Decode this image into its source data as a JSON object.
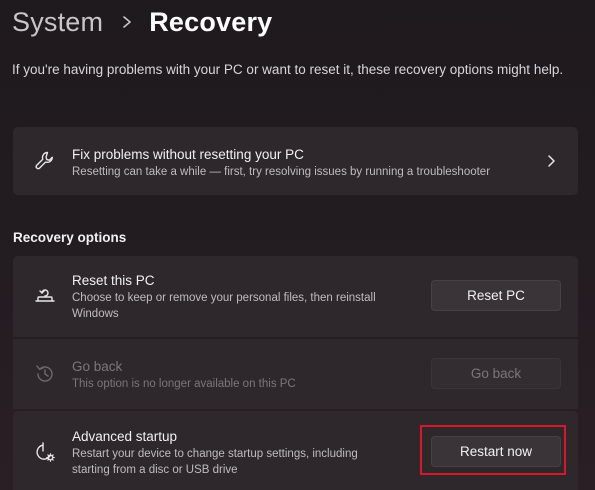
{
  "breadcrumb": {
    "parent": "System",
    "current": "Recovery",
    "separator_icon": "chevron-right-icon"
  },
  "intro_text": "If you're having problems with your PC or want to reset it, these recovery options might help.",
  "fix_card": {
    "icon": "wrench-icon",
    "title": "Fix problems without resetting your PC",
    "description": "Resetting can take a while — first, try resolving issues by running a troubleshooter",
    "chevron_icon": "chevron-right-icon"
  },
  "recovery_section": {
    "title": "Recovery options",
    "options": [
      {
        "icon": "reset-pc-icon",
        "title": "Reset this PC",
        "description": "Choose to keep or remove your personal files, then reinstall Windows",
        "button_label": "Reset PC",
        "enabled": true
      },
      {
        "icon": "history-icon",
        "title": "Go back",
        "description": "This option is no longer available on this PC",
        "button_label": "Go back",
        "enabled": false
      },
      {
        "icon": "advanced-startup-icon",
        "title": "Advanced startup",
        "description": "Restart your device to change startup settings, including starting from a disc or USB drive",
        "button_label": "Restart now",
        "enabled": true,
        "highlighted": true
      }
    ]
  },
  "colors": {
    "background": "#221c20",
    "card": "#2e282c",
    "button": "#3a3438",
    "highlight_outline": "#d8182a",
    "disabled_text": "#7c767a"
  }
}
